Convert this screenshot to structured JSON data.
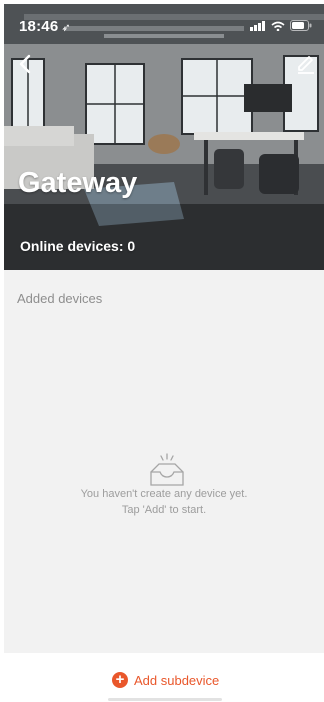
{
  "status_bar": {
    "time": "18:46"
  },
  "hero": {
    "title": "Gateway",
    "online_label": "Online devices: 0"
  },
  "devices": {
    "section_title": "Added devices",
    "empty_line1": "You haven't create any device yet.",
    "empty_line2": "Tap 'Add' to start."
  },
  "actions": {
    "add_subdevice": "Add subdevice"
  },
  "icons": {
    "back": "chevron-left-icon",
    "edit": "pencil-icon",
    "empty": "empty-inbox-icon",
    "add": "plus-circle-icon"
  },
  "colors": {
    "accent": "#e9572b",
    "panel_bg": "#f2f2f2",
    "muted_text": "#9d9d9d"
  }
}
